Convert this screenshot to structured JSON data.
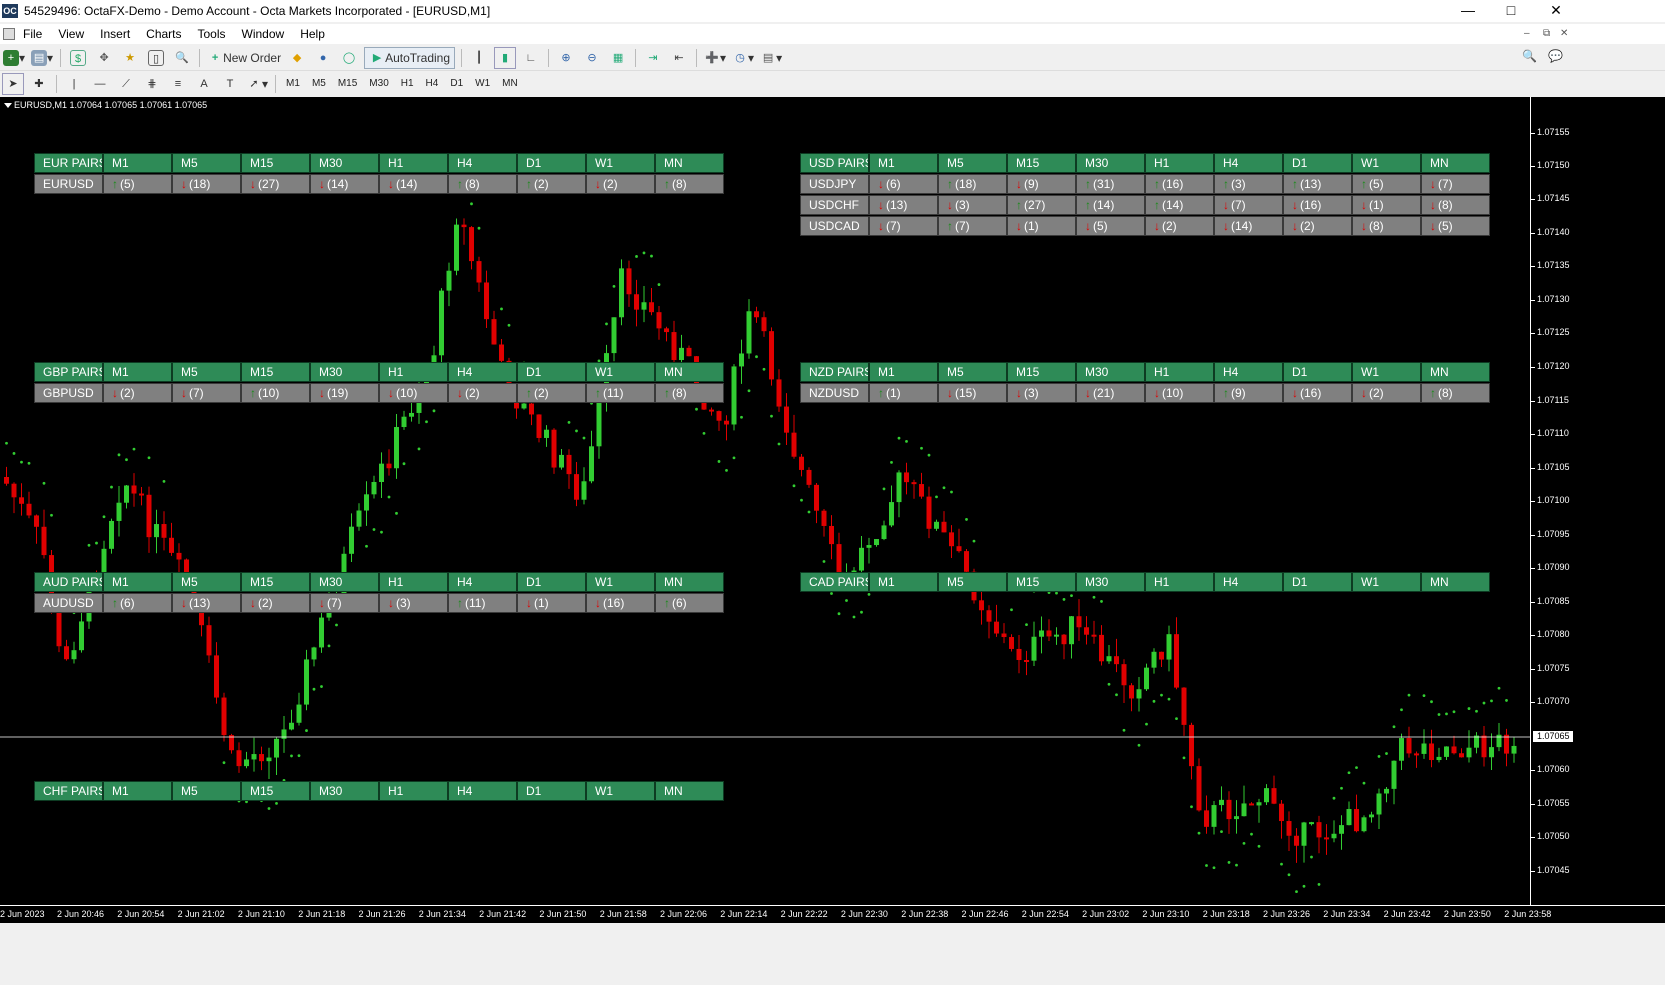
{
  "window": {
    "title": "54529496: OctaFX-Demo - Demo Account - Octa Markets Incorporated - [EURUSD,M1]",
    "app_icon": "OC"
  },
  "menu": [
    "File",
    "View",
    "Insert",
    "Charts",
    "Tools",
    "Window",
    "Help"
  ],
  "toolbar": {
    "new_order": "New Order",
    "autotrading": "AutoTrading",
    "timeframes": [
      "M1",
      "M5",
      "M15",
      "M30",
      "H1",
      "H4",
      "D1",
      "W1",
      "MN"
    ]
  },
  "chart": {
    "info": "EURUSD,M1  1.07064 1.07065 1.07061 1.07065",
    "current_price": "1.07065",
    "price_labels": [
      "1.07155",
      "1.07150",
      "1.07145",
      "1.07140",
      "1.07135",
      "1.07130",
      "1.07125",
      "1.07120",
      "1.07115",
      "1.07110",
      "1.07105",
      "1.07100",
      "1.07095",
      "1.07090",
      "1.07085",
      "1.07080",
      "1.07075",
      "1.07070",
      "1.07060",
      "1.07055",
      "1.07050",
      "1.07045"
    ],
    "time_labels": [
      "2 Jun 2023",
      "2 Jun 20:46",
      "2 Jun 20:54",
      "2 Jun 21:02",
      "2 Jun 21:10",
      "2 Jun 21:18",
      "2 Jun 21:26",
      "2 Jun 21:34",
      "2 Jun 21:42",
      "2 Jun 21:50",
      "2 Jun 21:58",
      "2 Jun 22:06",
      "2 Jun 22:14",
      "2 Jun 22:22",
      "2 Jun 22:30",
      "2 Jun 22:38",
      "2 Jun 22:46",
      "2 Jun 22:54",
      "2 Jun 23:02",
      "2 Jun 23:10",
      "2 Jun 23:18",
      "2 Jun 23:26",
      "2 Jun 23:34",
      "2 Jun 23:42",
      "2 Jun 23:50",
      "2 Jun 23:58"
    ],
    "colors": {
      "bull": "#32cd32",
      "bear": "#e00000",
      "sar": "#32cd32",
      "background": "#000000"
    }
  },
  "panels": [
    {
      "header": "EUR PAIRS",
      "rows": [
        {
          "pair": "EURUSD",
          "cells": [
            [
              "up",
              "(5)"
            ],
            [
              "down",
              "(18)"
            ],
            [
              "down",
              "(27)"
            ],
            [
              "down",
              "(14)"
            ],
            [
              "down",
              "(14)"
            ],
            [
              "up",
              "(8)"
            ],
            [
              "up",
              "(2)"
            ],
            [
              "down",
              "(2)"
            ],
            [
              "up",
              "(8)"
            ]
          ]
        }
      ]
    },
    {
      "header": "USD PAIRS",
      "rows": [
        {
          "pair": "USDJPY",
          "cells": [
            [
              "down",
              "(6)"
            ],
            [
              "up",
              "(18)"
            ],
            [
              "down",
              "(9)"
            ],
            [
              "up",
              "(31)"
            ],
            [
              "up",
              "(16)"
            ],
            [
              "up",
              "(3)"
            ],
            [
              "up",
              "(13)"
            ],
            [
              "up",
              "(5)"
            ],
            [
              "down",
              "(7)"
            ]
          ]
        },
        {
          "pair": "USDCHF",
          "cells": [
            [
              "down",
              "(13)"
            ],
            [
              "down",
              "(3)"
            ],
            [
              "up",
              "(27)"
            ],
            [
              "up",
              "(14)"
            ],
            [
              "up",
              "(14)"
            ],
            [
              "down",
              "(7)"
            ],
            [
              "down",
              "(16)"
            ],
            [
              "down",
              "(1)"
            ],
            [
              "down",
              "(8)"
            ]
          ]
        },
        {
          "pair": "USDCAD",
          "cells": [
            [
              "down",
              "(7)"
            ],
            [
              "up",
              "(7)"
            ],
            [
              "down",
              "(1)"
            ],
            [
              "down",
              "(5)"
            ],
            [
              "down",
              "(2)"
            ],
            [
              "down",
              "(14)"
            ],
            [
              "down",
              "(2)"
            ],
            [
              "down",
              "(8)"
            ],
            [
              "down",
              "(5)"
            ]
          ]
        }
      ]
    },
    {
      "header": "GBP PAIRS",
      "rows": [
        {
          "pair": "GBPUSD",
          "cells": [
            [
              "down",
              "(2)"
            ],
            [
              "down",
              "(7)"
            ],
            [
              "up",
              "(10)"
            ],
            [
              "down",
              "(19)"
            ],
            [
              "down",
              "(10)"
            ],
            [
              "down",
              "(2)"
            ],
            [
              "up",
              "(2)"
            ],
            [
              "up",
              "(11)"
            ],
            [
              "up",
              "(8)"
            ]
          ]
        }
      ]
    },
    {
      "header": "NZD PAIRS",
      "rows": [
        {
          "pair": "NZDUSD",
          "cells": [
            [
              "up",
              "(1)"
            ],
            [
              "down",
              "(15)"
            ],
            [
              "down",
              "(3)"
            ],
            [
              "down",
              "(21)"
            ],
            [
              "down",
              "(10)"
            ],
            [
              "up",
              "(9)"
            ],
            [
              "down",
              "(16)"
            ],
            [
              "down",
              "(2)"
            ],
            [
              "up",
              "(8)"
            ]
          ]
        }
      ]
    },
    {
      "header": "AUD PAIRS",
      "rows": [
        {
          "pair": "AUDUSD",
          "cells": [
            [
              "up",
              "(6)"
            ],
            [
              "down",
              "(13)"
            ],
            [
              "down",
              "(2)"
            ],
            [
              "down",
              "(7)"
            ],
            [
              "down",
              "(3)"
            ],
            [
              "up",
              "(11)"
            ],
            [
              "down",
              "(1)"
            ],
            [
              "down",
              "(16)"
            ],
            [
              "up",
              "(6)"
            ]
          ]
        }
      ]
    },
    {
      "header": "CAD PAIRS",
      "rows": []
    },
    {
      "header": "CHF PAIRS",
      "rows": []
    }
  ],
  "panel_timeframes": [
    "M1",
    "M5",
    "M15",
    "M30",
    "H1",
    "H4",
    "D1",
    "W1",
    "MN"
  ]
}
